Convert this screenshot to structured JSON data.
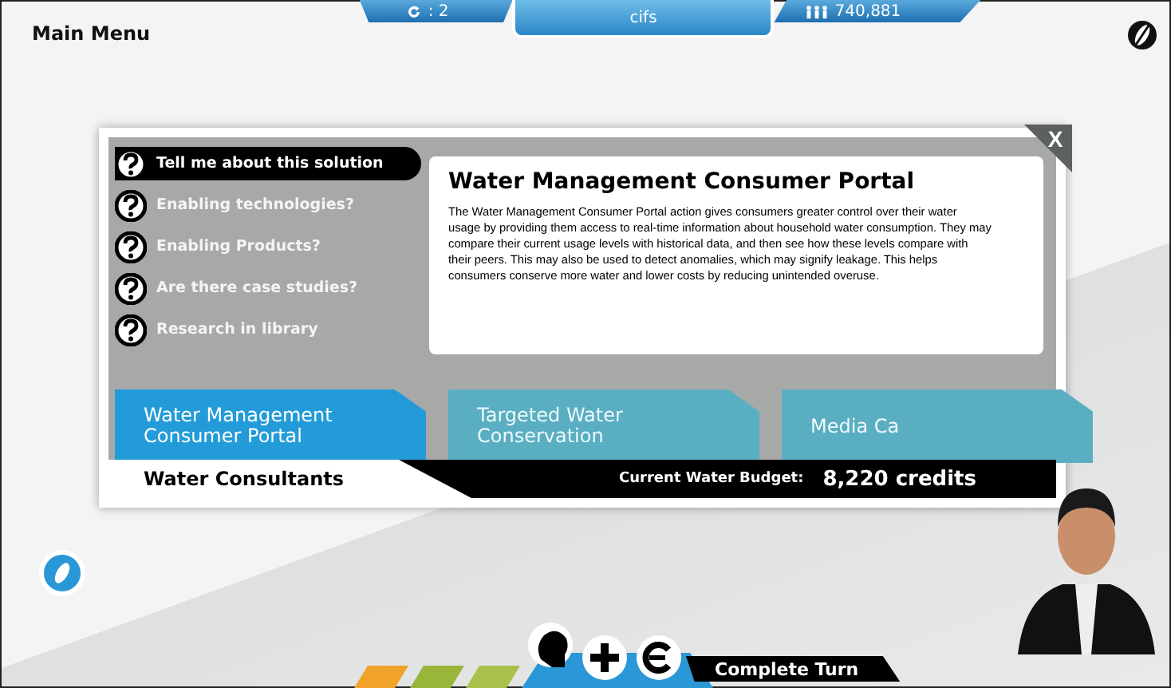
{
  "top_bar": {
    "menu_label": "Main Menu",
    "turn": ": 2",
    "title": "cifs",
    "population": "740,881"
  },
  "dialog": {
    "close": "X",
    "questions": [
      {
        "label": "Tell me about this solution",
        "selected": true
      },
      {
        "label": "Enabling technologies?",
        "selected": false
      },
      {
        "label": "Enabling Products?",
        "selected": false
      },
      {
        "label": "Are there case studies?",
        "selected": false
      },
      {
        "label": "Research in library",
        "selected": false
      }
    ],
    "info": {
      "title": "Water Management Consumer Portal",
      "body": "The Water Management Consumer Portal action gives consumers greater control over their water usage by providing them access to real-time information about household water consumption. They may compare their current usage levels with historical data, and then see how these levels compare with their peers. This may also be used to detect anomalies, which may signify leakage. This helps consumers conserve more water and lower costs by reducing unintended overuse."
    },
    "solutions": [
      {
        "label": "Water Management Consumer Portal",
        "selected": true
      },
      {
        "label": "Targeted Water Conservation",
        "selected": false
      },
      {
        "label": "Media Ca",
        "selected": false
      }
    ],
    "team": "Water Consultants",
    "budget_label": "Current Water Budget:",
    "budget": "8,220 credits"
  },
  "toolbar": {
    "end_turn": "Complete Turn"
  }
}
